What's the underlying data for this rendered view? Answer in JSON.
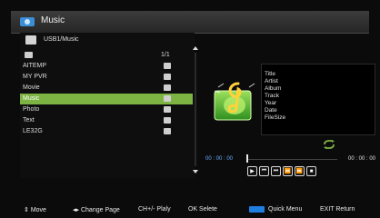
{
  "header": {
    "title": "Music",
    "icon": "music-icon"
  },
  "browser": {
    "path": "USB1/Music",
    "page_indicator": "1/1",
    "items": [
      {
        "label": "AITEMP"
      },
      {
        "label": "MY PVR"
      },
      {
        "label": "Movie"
      },
      {
        "label": "Music",
        "selected": true
      },
      {
        "label": "Photo"
      },
      {
        "label": "Text"
      },
      {
        "label": "LE32G"
      }
    ]
  },
  "info": {
    "fields": [
      "Title",
      "Artist",
      "Album",
      "Track",
      "Year",
      "Date",
      "FileSize"
    ]
  },
  "player": {
    "time_start": "00 : 00 : 00",
    "time_end": "00 : 00 : 00",
    "progress": 0,
    "controls": [
      {
        "name": "play-button",
        "glyph": "▶"
      },
      {
        "name": "previous-button",
        "glyph": "⏮"
      },
      {
        "name": "next-button",
        "glyph": "⏭"
      },
      {
        "name": "rewind-button",
        "glyph": "⏪"
      },
      {
        "name": "fast-forward-button",
        "glyph": "⏩"
      },
      {
        "name": "stop-button",
        "glyph": "■"
      }
    ]
  },
  "footer": {
    "move": "Move",
    "change_page": "Change Page",
    "chplay": "CH+/-  Plaly",
    "ok": "OK  Selete",
    "quick_menu": "Quick Menu",
    "exit": "EXIT  Return"
  },
  "colors": {
    "selection": "#7cb342",
    "accent_blue": "#1e7fe0",
    "repeat": "#7cb342"
  }
}
